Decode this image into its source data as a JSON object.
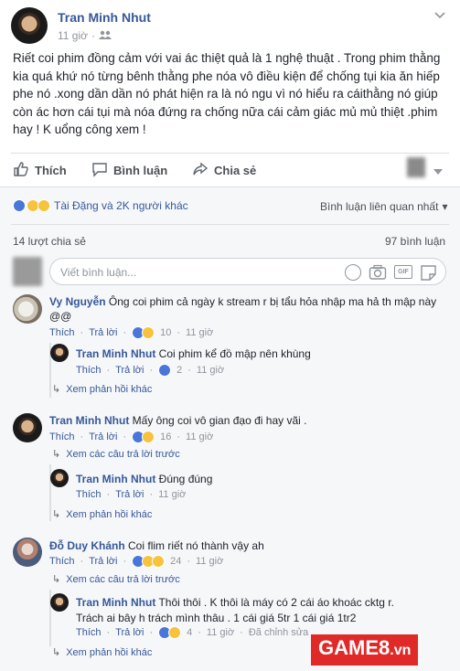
{
  "post": {
    "author": "Tran Minh Nhut",
    "time": "11 giờ",
    "privacy_icon": "people-icon",
    "content": "Riết coi phim đồng cảm với vai ác thiệt quả là 1 nghệ thuật . Trong phim thằng kia quá khứ nó từng bênh thằng phe nóa vô điều kiện để chống tụi kia ăn hiếp phe nó .xong dần dần nó phát hiện ra là nó ngu vì nó hiểu ra cáithằng nó giúp còn ác hơn cái tụi mà nóa đứng ra chống nữa cái cảm giác mủ mủ thiệt .phim hay ! K uổng công xem !"
  },
  "actions": {
    "like": "Thích",
    "comment": "Bình luận",
    "share": "Chia sẻ"
  },
  "reactions": {
    "summary": "Tài Đặng và 2K người khác",
    "sort_label": "Bình luận liên quan nhất",
    "shares": "14 lượt chia sẻ",
    "comments_count": "97 bình luận"
  },
  "composer": {
    "placeholder": "Viết bình luận..."
  },
  "comments": [
    {
      "author": "Vy Nguyễn",
      "text": "Ông coi phim cả ngày k stream r bị tẩu hỏa nhập ma hả th mập này @@",
      "like": "Thích",
      "reply": "Trả lời",
      "reacts": "10",
      "time": "11 giờ",
      "replies": [
        {
          "author": "Tran Minh Nhut",
          "text": "Coi phim kể đồ mập nên khùng",
          "like": "Thích",
          "reply": "Trả lời",
          "reacts": "2",
          "time": "11 giờ"
        }
      ],
      "more": "Xem phản hồi khác"
    },
    {
      "author": "Tran Minh Nhut",
      "text": "Mấy ông coi vô gian đạo đi hay vãi .",
      "like": "Thích",
      "reply": "Trả lời",
      "reacts": "16",
      "time": "11 giờ",
      "prev": "Xem các câu trả lời trước",
      "replies": [
        {
          "author": "Tran Minh Nhut",
          "text": "Đúng đúng",
          "like": "Thích",
          "reply": "Trả lời",
          "reacts": "",
          "time": "11 giờ"
        }
      ],
      "more": "Xem phản hồi khác"
    },
    {
      "author": "Đỗ Duy Khánh",
      "text": "Coi flim riết nó thành vậy ah",
      "like": "Thích",
      "reply": "Trả lời",
      "reacts": "24",
      "time": "11 giờ",
      "prev": "Xem các câu trả lời trước",
      "replies": [
        {
          "author": "Tran Minh Nhut",
          "text": "Thôi thôi . K thôi là máy có 2 cái áo khoác cktg r. Trách ai bây h trách mình thâu . 1 cái giá 5tr 1 cái giá 1tr2",
          "like": "Thích",
          "reply": "Trả lời",
          "reacts": "4",
          "time": "11 giờ",
          "edited": "Đã chỉnh sửa"
        }
      ],
      "more": "Xem phản hồi khác"
    }
  ],
  "watermark": {
    "main": "GAME8",
    "suffix": ".vn"
  },
  "colors": {
    "link": "#365899",
    "muted": "#90949c",
    "brand_red": "#e02a27"
  }
}
